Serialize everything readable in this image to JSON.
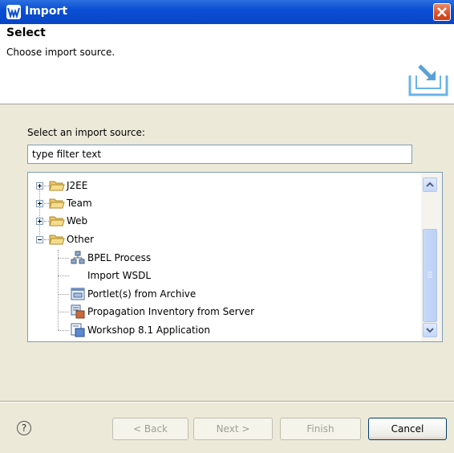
{
  "window": {
    "title": "Import",
    "close_icon": "close-icon"
  },
  "header": {
    "title": "Select",
    "description": "Choose import source."
  },
  "source": {
    "label": "Select an import source:",
    "filter_value": "type filter text"
  },
  "tree": {
    "items": [
      {
        "label": "J2EE",
        "icon": "folder-icon",
        "expander": "plus"
      },
      {
        "label": "Team",
        "icon": "folder-icon",
        "expander": "plus"
      },
      {
        "label": "Web",
        "icon": "folder-icon",
        "expander": "plus"
      },
      {
        "label": "Other",
        "icon": "folder-icon",
        "expander": "minus"
      },
      {
        "label": "BPEL Process",
        "icon": "bpel-icon"
      },
      {
        "label": "Import WSDL",
        "icon": ""
      },
      {
        "label": "Portlet(s) from Archive",
        "icon": "portlet-icon"
      },
      {
        "label": "Propagation Inventory from Server",
        "icon": "propagation-icon"
      },
      {
        "label": "Workshop 8.1 Application",
        "icon": "workshop-icon"
      }
    ]
  },
  "buttons": {
    "help": "?",
    "back": "< Back",
    "next": "Next >",
    "finish": "Finish",
    "cancel": "Cancel"
  }
}
